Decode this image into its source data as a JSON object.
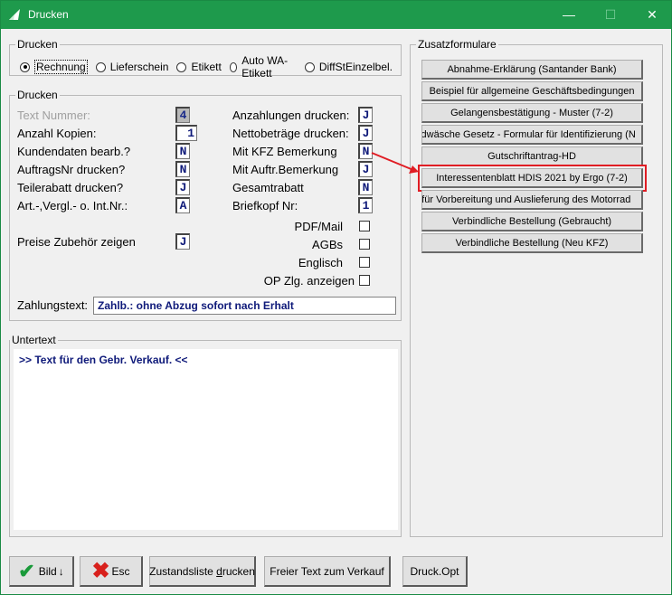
{
  "window": {
    "title": "Drucken"
  },
  "type_group": {
    "legend": "Drucken",
    "options": [
      {
        "label": "Rechnung",
        "selected": true
      },
      {
        "label": "Lieferschein",
        "selected": false
      },
      {
        "label": "Etikett",
        "selected": false
      },
      {
        "label": "Auto WA-Etikett",
        "selected": false
      },
      {
        "label": "DiffStEinzelbel.",
        "selected": false
      }
    ]
  },
  "print_group": {
    "legend": "Drucken",
    "left": [
      {
        "label": "Text Nummer:",
        "value": "4",
        "disabled": true
      },
      {
        "label": "Anzahl Kopien:",
        "value": "1"
      },
      {
        "label": "Kundendaten bearb.?",
        "value": "N"
      },
      {
        "label": "AuftragsNr drucken?",
        "value": "N"
      },
      {
        "label": "Teilerabatt drucken?",
        "value": "J"
      },
      {
        "label": "Art.-,Vergl.- o. Int.Nr.:",
        "value": "A"
      }
    ],
    "right": [
      {
        "label": "Anzahlungen drucken:",
        "value": "J"
      },
      {
        "label": "Nettobeträge drucken:",
        "value": "J"
      },
      {
        "label": "Mit KFZ Bemerkung",
        "value": "N"
      },
      {
        "label": "Mit Auftr.Bemerkung",
        "value": "J"
      },
      {
        "label": "Gesamtrabatt",
        "value": "N"
      },
      {
        "label": "Briefkopf Nr:",
        "value": "1"
      }
    ],
    "preise": {
      "label": "Preise Zubehör zeigen",
      "value": "J"
    },
    "checkboxes": [
      {
        "label": "PDF/Mail",
        "checked": false
      },
      {
        "label": "AGBs",
        "checked": false
      },
      {
        "label": "Englisch",
        "checked": false
      },
      {
        "label": "OP Zlg. anzeigen",
        "checked": false
      }
    ],
    "zahlungstext": {
      "label": "Zahlungstext:",
      "value": "Zahlb.: ohne Abzug sofort nach Erhalt"
    }
  },
  "untertext": {
    "legend": "Untertext",
    "value": ">> Text für den Gebr. Verkauf. <<"
  },
  "zusatz": {
    "legend": "Zusatzformulare",
    "buttons": [
      "Abnahme-Erklärung (Santander Bank)",
      "Beispiel für allgemeine Geschäftsbedingungen",
      "Gelangensbestätigung - Muster (7-2)",
      "eldwäsche Gesetz - Formular für Identifizierung (N",
      "Gutschriftantrag-HD",
      "Interessentenblatt HDIS 2021 by Ergo (7-2)",
      "e für Vorbereitung und Auslieferung des Motorrad",
      "Verbindliche Bestellung (Gebraucht)",
      "Verbindliche Bestellung (Neu KFZ)"
    ]
  },
  "bottom": {
    "bild": "Bild",
    "bild_arrow": "↓",
    "esc": "Esc",
    "zustand_pre": "Zustandsliste ",
    "zustand_ul": "d",
    "zustand_post": "rucken",
    "freier": "Freier Text zum Verkauf",
    "druckopt": "Druck.Opt"
  },
  "colors": {
    "titlebar": "#1e9a4c",
    "highlight": "#e01d24",
    "field_text": "#0f1a7a"
  }
}
